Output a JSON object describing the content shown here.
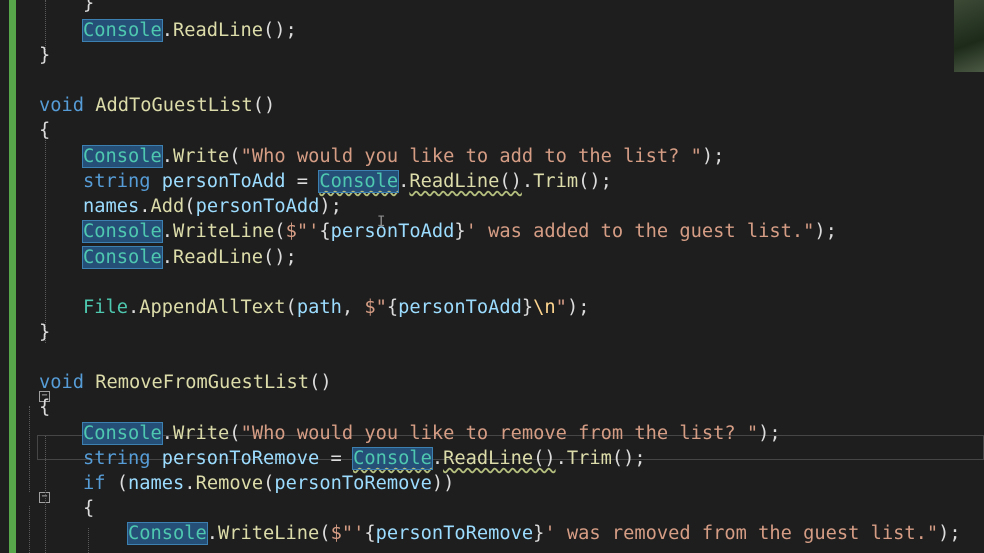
{
  "editor": {
    "lines": [
      {
        "tokens": [
          [
            "plain",
            "}"
          ]
        ]
      },
      {
        "tokens": [
          [
            "hl",
            "Console"
          ],
          [
            "plain",
            "."
          ],
          [
            "method",
            "ReadLine"
          ],
          [
            "plain",
            "();"
          ]
        ]
      },
      {
        "tokens": [
          [
            "plain",
            "}"
          ]
        ]
      },
      {
        "tokens": []
      },
      {
        "tokens": [
          [
            "kw",
            "void"
          ],
          [
            "plain",
            " "
          ],
          [
            "method",
            "AddToGuestList"
          ],
          [
            "plain",
            "()"
          ]
        ]
      },
      {
        "tokens": [
          [
            "plain",
            "{"
          ]
        ]
      },
      {
        "tokens": [
          [
            "hl",
            "Console"
          ],
          [
            "plain",
            "."
          ],
          [
            "method",
            "Write"
          ],
          [
            "plain",
            "("
          ],
          [
            "str",
            "\"Who would you like to add to the list? \""
          ],
          [
            "plain",
            ");"
          ]
        ]
      },
      {
        "tokens": [
          [
            "kw",
            "string"
          ],
          [
            "plain",
            " "
          ],
          [
            "var",
            "personToAdd"
          ],
          [
            "plain",
            " = "
          ],
          [
            "hlsq",
            "Console"
          ],
          [
            "plain",
            "."
          ],
          [
            "methodsq",
            "ReadLine"
          ],
          [
            "plainsq",
            "()"
          ],
          [
            "plain",
            "."
          ],
          [
            "method",
            "Trim"
          ],
          [
            "plain",
            "();"
          ]
        ]
      },
      {
        "tokens": [
          [
            "var",
            "names"
          ],
          [
            "plain",
            "."
          ],
          [
            "method",
            "Add"
          ],
          [
            "plain",
            "("
          ],
          [
            "var",
            "personToAdd"
          ],
          [
            "plain",
            ");"
          ]
        ]
      },
      {
        "tokens": [
          [
            "hl",
            "Console"
          ],
          [
            "plain",
            "."
          ],
          [
            "method",
            "WriteLine"
          ],
          [
            "plain",
            "("
          ],
          [
            "str",
            "$\"'"
          ],
          [
            "plain",
            "{"
          ],
          [
            "var",
            "personToAdd"
          ],
          [
            "plain",
            "}"
          ],
          [
            "str",
            "' was added to the guest list.\""
          ],
          [
            "plain",
            ");"
          ]
        ]
      },
      {
        "tokens": [
          [
            "hl",
            "Console"
          ],
          [
            "plain",
            "."
          ],
          [
            "method",
            "ReadLine"
          ],
          [
            "plain",
            "();"
          ]
        ]
      },
      {
        "tokens": []
      },
      {
        "tokens": [
          [
            "type",
            "File"
          ],
          [
            "plain",
            "."
          ],
          [
            "method",
            "AppendAllText"
          ],
          [
            "plain",
            "("
          ],
          [
            "var",
            "path"
          ],
          [
            "plain",
            ", "
          ],
          [
            "str",
            "$\""
          ],
          [
            "plain",
            "{"
          ],
          [
            "var",
            "personToAdd"
          ],
          [
            "plain",
            "}"
          ],
          [
            "esc",
            "\\n"
          ],
          [
            "str",
            "\""
          ],
          [
            "plain",
            ");"
          ]
        ]
      },
      {
        "tokens": [
          [
            "plain",
            "}"
          ]
        ]
      },
      {
        "tokens": []
      },
      {
        "tokens": [
          [
            "kw",
            "void"
          ],
          [
            "plain",
            " "
          ],
          [
            "method",
            "RemoveFromGuestList"
          ],
          [
            "plain",
            "()"
          ]
        ]
      },
      {
        "tokens": [
          [
            "plain",
            "{"
          ]
        ]
      },
      {
        "tokens": [
          [
            "hl",
            "Console"
          ],
          [
            "plain",
            "."
          ],
          [
            "method",
            "Write"
          ],
          [
            "plain",
            "("
          ],
          [
            "str",
            "\"Who would you like to remove from the list? \""
          ],
          [
            "plain",
            ");"
          ]
        ]
      },
      {
        "tokens": [
          [
            "kw",
            "string"
          ],
          [
            "plain",
            " "
          ],
          [
            "var",
            "personToRemove"
          ],
          [
            "plain",
            " = "
          ],
          [
            "hlsq",
            "Console"
          ],
          [
            "plain",
            "."
          ],
          [
            "methodsq",
            "ReadLine"
          ],
          [
            "plainsq",
            "()"
          ],
          [
            "plain",
            "."
          ],
          [
            "method",
            "Trim"
          ],
          [
            "plain",
            "();"
          ]
        ]
      },
      {
        "tokens": [
          [
            "kw",
            "if"
          ],
          [
            "plain",
            " ("
          ],
          [
            "var",
            "names"
          ],
          [
            "plain",
            "."
          ],
          [
            "method",
            "Remove"
          ],
          [
            "plain",
            "("
          ],
          [
            "var",
            "personToRemove"
          ],
          [
            "plain",
            "))"
          ]
        ]
      },
      {
        "tokens": [
          [
            "plain",
            "{"
          ]
        ]
      },
      {
        "tokens": [
          [
            "hl",
            "Console"
          ],
          [
            "plain",
            "."
          ],
          [
            "method",
            "WriteLine"
          ],
          [
            "plain",
            "("
          ],
          [
            "str",
            "$\"'"
          ],
          [
            "plain",
            "{"
          ],
          [
            "var",
            "personToRemove"
          ],
          [
            "plain",
            "}"
          ],
          [
            "str",
            "' was removed from the guest list.\""
          ],
          [
            "plain",
            ");"
          ]
        ]
      }
    ]
  },
  "colors": {
    "background": "#1e1e1e",
    "keyword": "#569cd6",
    "type": "#4ec9b0",
    "method": "#dcdcaa",
    "string": "#d69d85",
    "variable": "#9cdcfe",
    "change_bar": "#57a64a"
  }
}
